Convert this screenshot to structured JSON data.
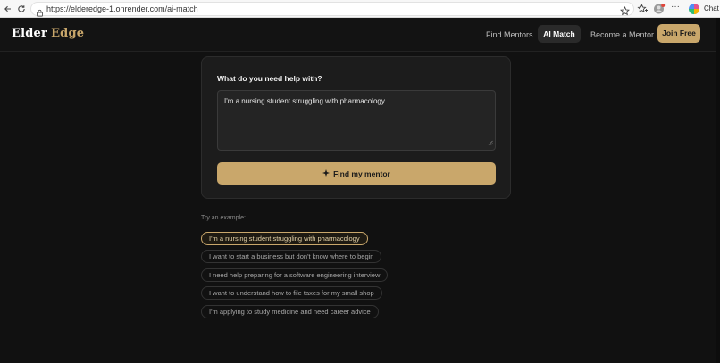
{
  "browser": {
    "url": "https://elderedge-1.onrender.com/ai-match",
    "chat_label": "Chat"
  },
  "header": {
    "brand_primary": "Elder",
    "brand_accent": "Edge",
    "nav": {
      "find_mentors": "Find Mentors",
      "ai_match": "AI Match",
      "become_mentor": "Become a Mentor",
      "join_free": "Join Free"
    }
  },
  "card": {
    "question": "What do you need help with?",
    "input_value": "I'm a nursing student struggling with pharmacology",
    "submit_label": "Find my mentor"
  },
  "examples": {
    "label": "Try an example:",
    "items": [
      "I'm a nursing student struggling with pharmacology",
      "I want to start a business but don't know where to begin",
      "I need help preparing for a software engineering interview",
      "I want to understand how to file taxes for my small shop",
      "I'm applying to study medicine and need career advice"
    ],
    "selected_index": 0
  },
  "colors": {
    "accent": "#c9a76b",
    "background": "#111111",
    "card": "#1c1c1c"
  }
}
